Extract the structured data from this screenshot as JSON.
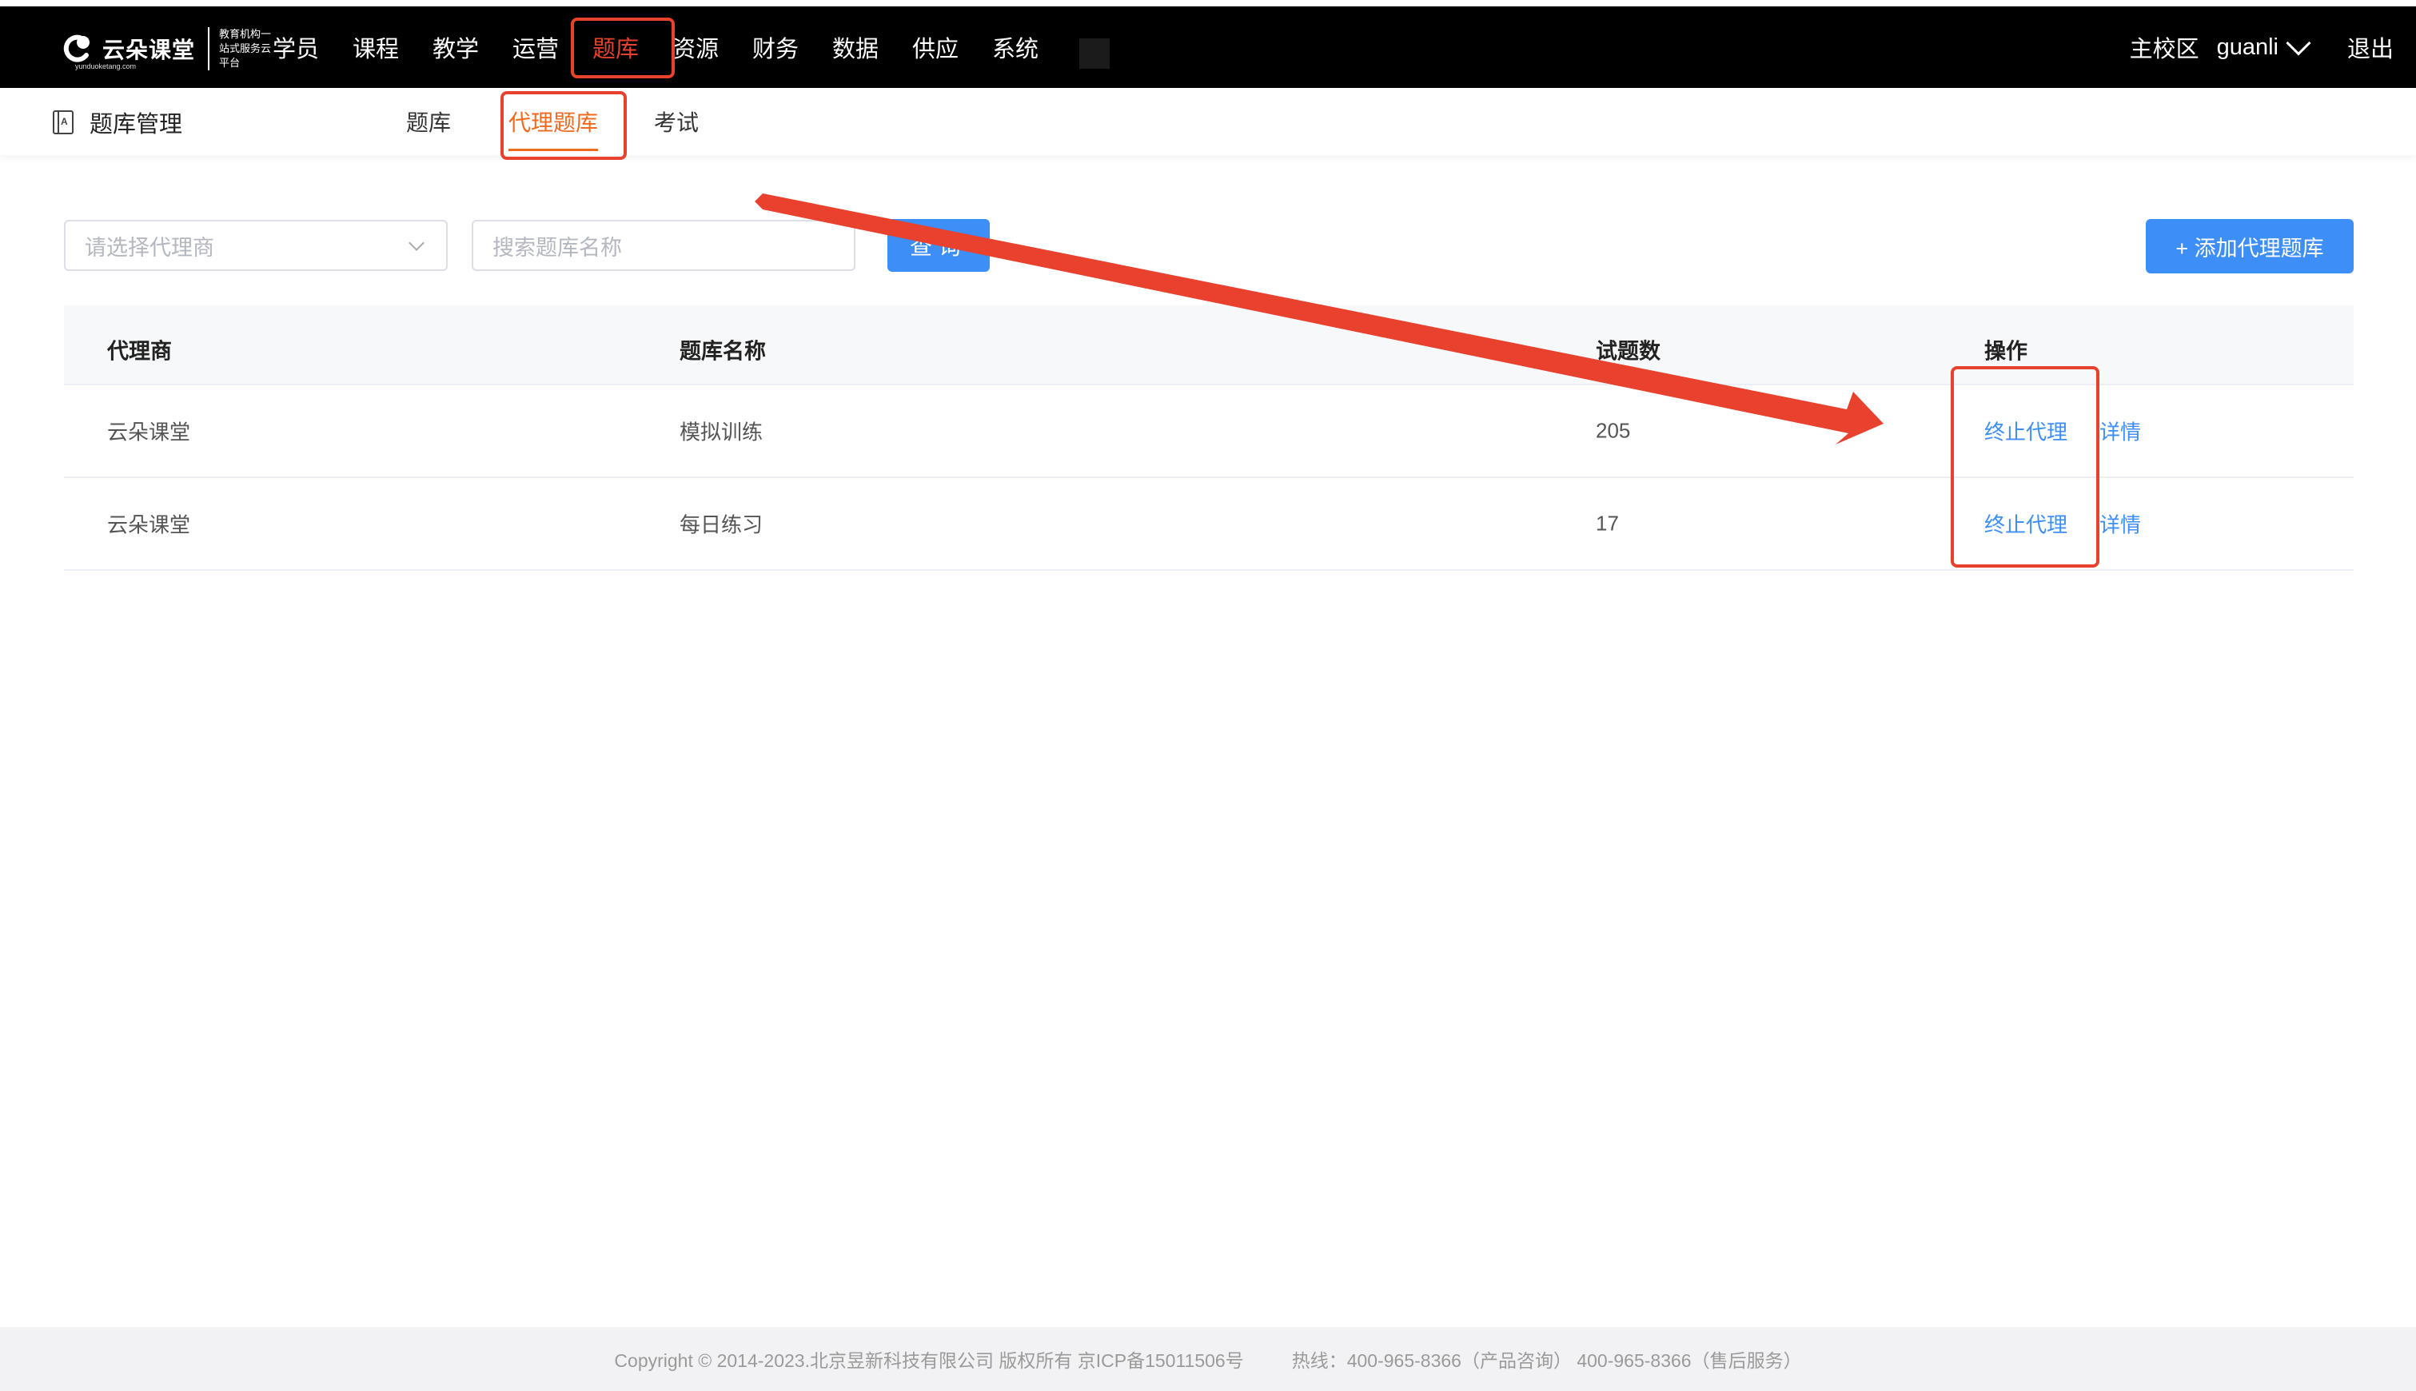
{
  "brand": {
    "name": "云朵课堂",
    "tagline": "教育机构一站式服务云平台",
    "domain": "yunduoketang.com"
  },
  "nav": {
    "items": [
      "学员",
      "课程",
      "教学",
      "运营",
      "题库",
      "资源",
      "财务",
      "数据",
      "供应",
      "系统"
    ],
    "active": "题库"
  },
  "user": {
    "campus": "主校区",
    "username": "guanli",
    "logout": "退出"
  },
  "module": {
    "title": "题库管理",
    "tabs": [
      "题库",
      "代理题库",
      "考试"
    ],
    "active_tab": "代理题库"
  },
  "filters": {
    "agent_placeholder": "请选择代理商",
    "search_placeholder": "搜索题库名称",
    "query_label": "查询",
    "add_label": "+ 添加代理题库"
  },
  "table": {
    "headers": [
      "代理商",
      "题库名称",
      "试题数",
      "操作"
    ],
    "rows": [
      {
        "agent": "云朵课堂",
        "bank": "模拟训练",
        "count": "205",
        "action_stop": "终止代理",
        "action_detail": "详情"
      },
      {
        "agent": "云朵课堂",
        "bank": "每日练习",
        "count": "17",
        "action_stop": "终止代理",
        "action_detail": "详情"
      }
    ]
  },
  "footer": {
    "copyright": "Copyright © 2014-2023.北京昱新科技有限公司 版权所有 京ICP备15011506号",
    "hotline": "热线：400-965-8366（产品咨询） 400-965-8366（售后服务）"
  },
  "colors": {
    "accent_blue": "#3d8ef7",
    "active_orange": "#f06a1e",
    "annotation_red": "#e8412e"
  }
}
